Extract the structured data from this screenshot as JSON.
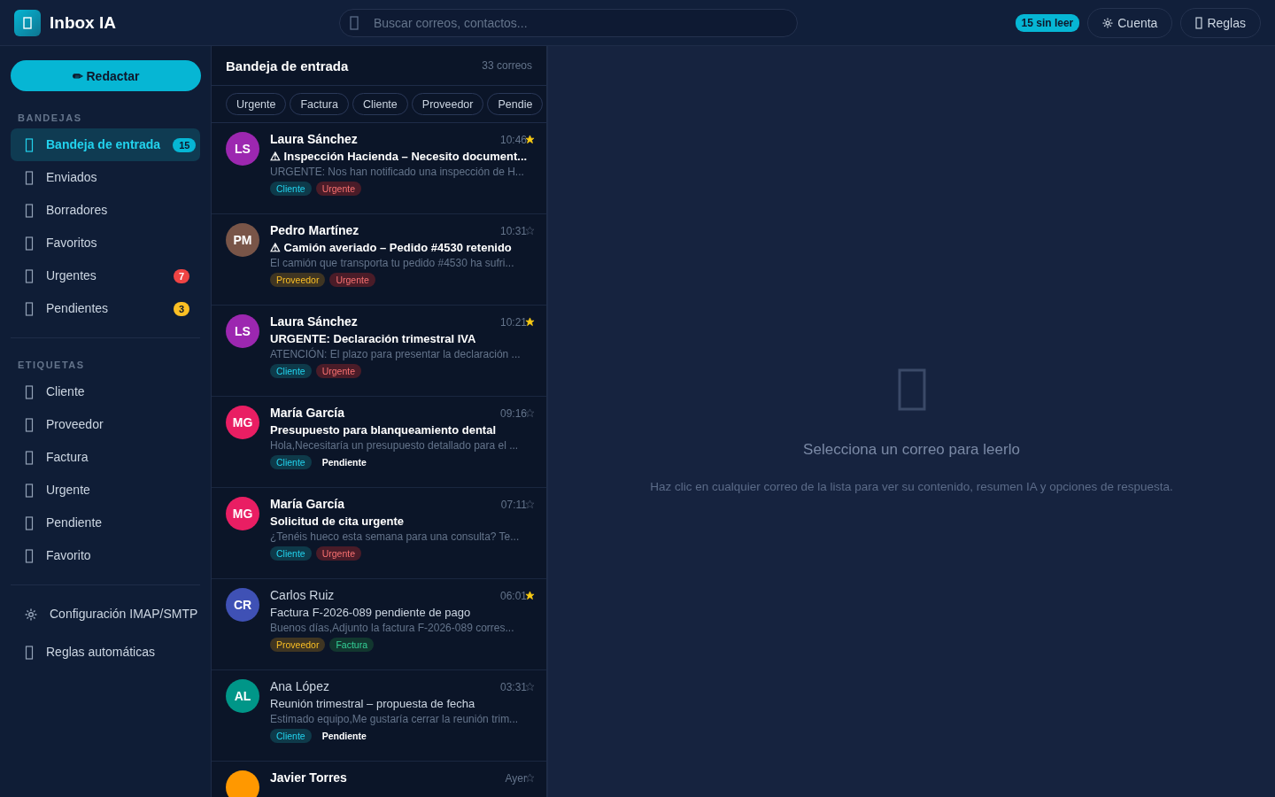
{
  "app": {
    "title": "Inbox IA"
  },
  "search": {
    "placeholder": "Buscar correos, contactos..."
  },
  "header": {
    "unread_badge": "15 sin leer",
    "buttons": [
      {
        "kind": "gear",
        "label": "Cuenta"
      },
      {
        "kind": "box",
        "label": "Reglas"
      }
    ]
  },
  "compose_button": "✏ Redactar",
  "sidebar": {
    "sections": [
      {
        "title": "BANDEJAS",
        "items": [
          {
            "kind": "box",
            "label": "Bandeja de entrada",
            "selected": true,
            "badge": "15",
            "color": "#06b6d4"
          },
          {
            "kind": "box",
            "label": "Enviados",
            "selected": false
          },
          {
            "kind": "box",
            "label": "Borradores",
            "selected": false
          },
          {
            "kind": "box",
            "label": "Favoritos",
            "selected": false
          },
          {
            "kind": "box",
            "label": "Urgentes",
            "selected": false,
            "badge": "7",
            "color": "#ef4444"
          },
          {
            "kind": "box",
            "label": "Pendientes",
            "selected": false,
            "badge": "3",
            "color": "#fbbf24"
          }
        ]
      },
      {
        "title": "ETIQUETAS",
        "items": [
          {
            "kind": "box",
            "label": "Cliente",
            "selected": false
          },
          {
            "kind": "box",
            "label": "Proveedor",
            "selected": false
          },
          {
            "kind": "box",
            "label": "Factura",
            "selected": false
          },
          {
            "kind": "box",
            "label": "Urgente",
            "selected": false
          },
          {
            "kind": "box",
            "label": "Pendiente",
            "selected": false
          },
          {
            "kind": "box",
            "label": "Favorito",
            "selected": false
          }
        ]
      },
      {
        "items": [
          {
            "kind": "gear",
            "label": "Configuración IMAP/SMTP",
            "selected": false
          },
          {
            "kind": "box",
            "label": "Reglas automáticas",
            "selected": false
          }
        ]
      }
    ]
  },
  "list": {
    "title": "Bandeja de entrada",
    "count": "33 correos",
    "filters": [
      "Urgente",
      "Factura",
      "Cliente",
      "Proveedor",
      "Pendie"
    ],
    "emails": [
      {
        "initials": "LS",
        "color": "#9c27b0",
        "sender": "Laura Sánchez",
        "time": "10:46",
        "starred": true,
        "unread": true,
        "subject": "⚠ Inspección Hacienda – Necesito document...",
        "preview": "URGENTE: Nos han notificado una inspección de H...",
        "tags": [
          {
            "kind": "cliente",
            "label": "Cliente"
          },
          {
            "kind": "urgente",
            "label": "Urgente"
          }
        ]
      },
      {
        "initials": "PM",
        "color": "#795548",
        "sender": "Pedro Martínez",
        "time": "10:31",
        "starred": false,
        "unread": true,
        "subject": "⚠ Camión averiado – Pedido #4530 retenido",
        "preview": "El camión que transporta tu pedido #4530 ha sufri...",
        "tags": [
          {
            "kind": "proveedor",
            "label": "Proveedor"
          },
          {
            "kind": "urgente",
            "label": "Urgente"
          }
        ]
      },
      {
        "initials": "LS",
        "color": "#9c27b0",
        "sender": "Laura Sánchez",
        "time": "10:21",
        "starred": true,
        "unread": true,
        "subject": "URGENTE: Declaración trimestral IVA",
        "preview": "ATENCIÓN: El plazo para presentar la declaración ...",
        "tags": [
          {
            "kind": "cliente",
            "label": "Cliente"
          },
          {
            "kind": "urgente",
            "label": "Urgente"
          }
        ]
      },
      {
        "initials": "MG",
        "color": "#e91e63",
        "sender": "María García",
        "time": "09:16",
        "starred": false,
        "unread": true,
        "subject": "Presupuesto para blanqueamiento dental",
        "preview": "Hola,Necesitaría un presupuesto detallado para el ...",
        "tags": [
          {
            "kind": "cliente",
            "label": "Cliente"
          },
          {
            "kind": "pendiente",
            "label": "Pendiente"
          }
        ]
      },
      {
        "initials": "MG",
        "color": "#e91e63",
        "sender": "María García",
        "time": "07:11",
        "starred": false,
        "unread": true,
        "subject": "Solicitud de cita urgente",
        "preview": "¿Tenéis hueco esta semana para una consulta? Te...",
        "tags": [
          {
            "kind": "cliente",
            "label": "Cliente"
          },
          {
            "kind": "urgente",
            "label": "Urgente"
          }
        ]
      },
      {
        "initials": "CR",
        "color": "#3f51b5",
        "sender": "Carlos Ruiz",
        "time": "06:01",
        "starred": true,
        "unread": false,
        "subject": "Factura F-2026-089 pendiente de pago",
        "preview": "Buenos días,Adjunto la factura F-2026-089 corres...",
        "tags": [
          {
            "kind": "proveedor",
            "label": "Proveedor"
          },
          {
            "kind": "factura",
            "label": "Factura"
          }
        ]
      },
      {
        "initials": "AL",
        "color": "#009688",
        "sender": "Ana López",
        "time": "03:31",
        "starred": false,
        "unread": false,
        "subject": "Reunión trimestral – propuesta de fecha",
        "preview": "Estimado equipo,Me gustaría cerrar la reunión trim...",
        "tags": [
          {
            "kind": "cliente",
            "label": "Cliente"
          },
          {
            "kind": "pendiente",
            "label": "Pendiente"
          }
        ]
      },
      {
        "color": "#ff9800",
        "sender": "Javier Torres",
        "time": "Ayer",
        "starred": false,
        "unread": true
      }
    ]
  },
  "reader": {
    "title": "Selecciona un correo para leerlo",
    "hint": "Haz clic en cualquier correo de la lista para ver su contenido, resumen IA y opciones de respuesta."
  }
}
